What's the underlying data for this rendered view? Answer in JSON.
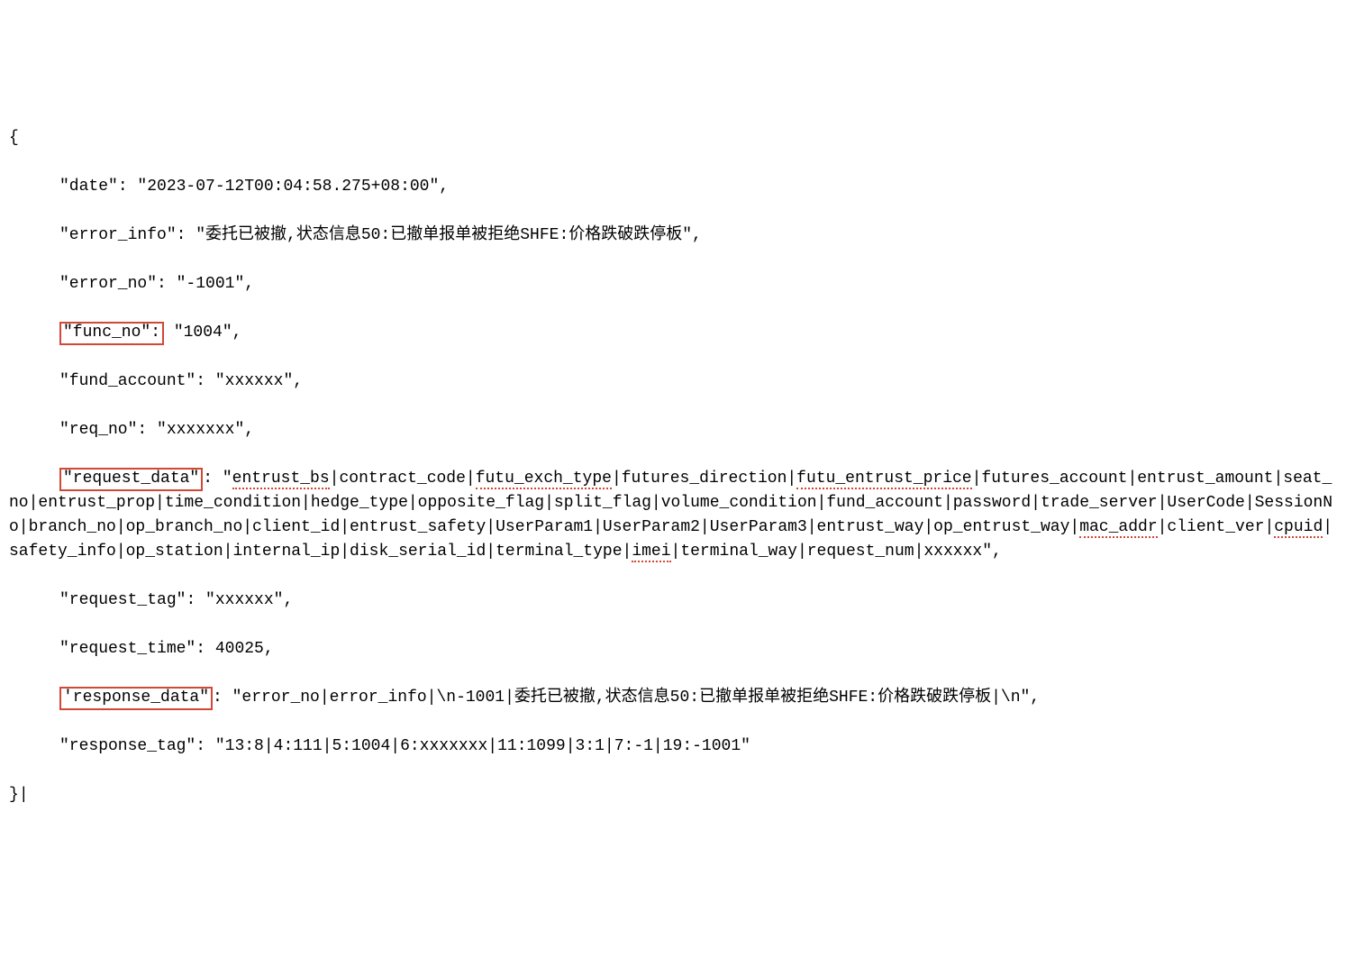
{
  "json": {
    "open_brace": "{",
    "close_brace": "}",
    "cursor_marker": "|",
    "date_key": "\"date\"",
    "date_val": ": \"2023-07-12T00:04:58.275+08:00\",",
    "error_info_key": "\"error_info\"",
    "error_info_val": ": \"委托已被撤,状态信息50:已撤单报单被拒绝SHFE:价格跌破跌停板\",",
    "error_no_key": "\"error_no\"",
    "error_no_val": ": \"-1001\",",
    "func_no_key": "\"func_no\":",
    "func_no_val": " \"1004\",",
    "fund_account_key": "\"fund_account\"",
    "fund_account_val": ": \"xxxxxx\",",
    "req_no_key": "\"req_no\"",
    "req_no_val": ": \"xxxxxxx\",",
    "request_data_key": "\"request_data\"",
    "request_data_prefix": ": \"",
    "rd_1": "entrust_bs",
    "rd_2": "|contract_code|",
    "rd_3": "futu_exch_type",
    "rd_4": "|futures_direction|",
    "rd_5": "futu_entrust_price",
    "rd_6": "|futures_account|entrust_amount|seat_no|entrust_prop|time_condition|hedge_type|opposite_flag|split_flag|volume_condition|fund_account|password|trade_server|UserCode|SessionNo|branch_no|op_branch_no|client_id|entrust_safety|UserParam1|UserParam2|UserParam3|entrust_way|op_entrust_way|",
    "rd_7": "mac_addr",
    "rd_8": "|client_ver|",
    "rd_9": "cpuid",
    "rd_10": "|safety_info|op_station|internal_ip|disk_serial_id|terminal_type|",
    "rd_11": "imei",
    "rd_12": "|terminal_way|request_num|xxxxxx\",",
    "request_tag_key": "\"request_tag\"",
    "request_tag_val": ": \"xxxxxx\",",
    "request_time_key": "\"request_time\"",
    "request_time_val": ": 40025,",
    "response_data_key": "'response_data\"",
    "response_data_val": ": \"error_no|error_info|\\n-1001|委托已被撤,状态信息50:已撤单报单被拒绝SHFE:价格跌破跌停板|\\n\",",
    "response_tag_key": "\"response_tag\"",
    "response_tag_val": ": \"13:8|4:111|5:1004|6:xxxxxxx|11:1099|3:1|7:-1|19:-1001\""
  }
}
